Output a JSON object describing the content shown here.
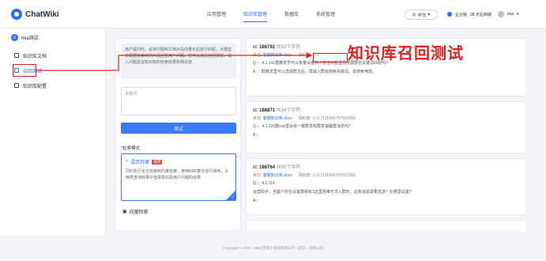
{
  "app": {
    "name": "ChatWiki"
  },
  "nav": {
    "items": [
      "应用管理",
      "知识库管理",
      "数据库",
      "系统管理"
    ],
    "active_index": 1
  },
  "header": {
    "lang": "中文",
    "company": "企业版",
    "user_info": "38 天后到期",
    "username": "mia"
  },
  "sidebar": {
    "kb_name": "mia测试",
    "kb_badge": "G",
    "items": [
      "知识库文档",
      "召回测试",
      "知识库配置"
    ],
    "active_index": 1
  },
  "left": {
    "description": "用户提问时，会将问题和文档片段向量化后进行匹配，大模型会根据检索到的片段回答用户问题。您可以通过召回测试，输入问题验证知识库的检索效果和相关度",
    "query_placeholder": "关键词",
    "test_button": "测试",
    "mode_label": "检索模式",
    "mode_required": "*",
    "mode1_title": "混合检索",
    "mode1_tag": "推荐",
    "mode1_desc": "同时执行全文检索和向量检索，使用RRF算法进行排序，从两类查询结果中选择更匹配用户问题的结果",
    "mode2_title": "向量检索"
  },
  "results": [
    {
      "id_label": "id:",
      "id": "186792",
      "count": "共52个字符",
      "source_label": "来自:",
      "source": "客服知识库.docx",
      "score_label": "相似度:",
      "score": "1",
      "q": "Q：：4.1.141群教发号可以批量设置到个群主的群里再根据群名关键词匹配吗?",
      "a": "A：：群教发里可以选择群主后，再输入群名搜索关键词，去搜索筛选。"
    },
    {
      "id_label": "id:",
      "id": "186871",
      "count": "共34个字符",
      "source_label": "来自:",
      "source": "客服知识库.docx",
      "score_label": "相似度:",
      "score": "0.7126566767692566",
      "q": "Q：：4.1.220群sop里会有一键群发和群发提醒群消息吗?",
      "a": "A：："
    },
    {
      "id_label": "id:",
      "id": "186764",
      "count": "共55个字符",
      "source_label": "来自:",
      "source": "客服知识库.docx",
      "score_label": "相似度:",
      "score": "0.7126566767692566",
      "q": "Q：：4.1.114",
      "extra": "运营助手，当客户所在设置群组有1这里困难无法入群时，这条消息需要发送？在哪里设置?",
      "a": "A：："
    },
    {
      "id_label": "",
      "id": "",
      "count": "",
      "source_label": "",
      "source": "",
      "score_label": "",
      "score": "",
      "q": "",
      "a": ""
    }
  ],
  "annotation": {
    "text": "知识库召回测试",
    "color": "#e02020"
  },
  "footer": {
    "text": "Copyright © 2019 - 2024 芝麻小客服有限公司（武汉）有限公司"
  }
}
